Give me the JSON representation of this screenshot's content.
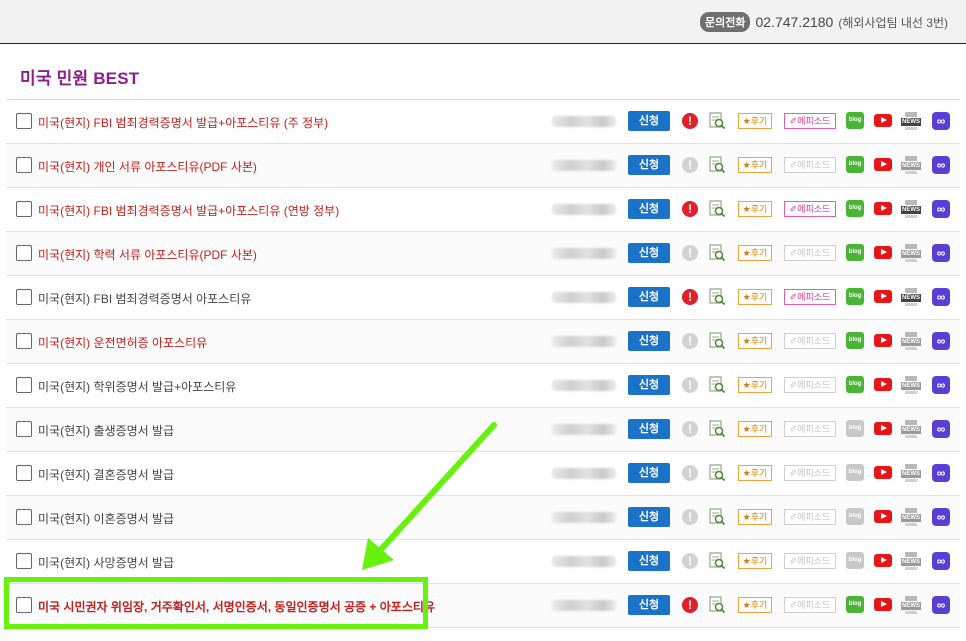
{
  "header": {
    "contact_badge": "문의전화",
    "phone": "02.747.2180",
    "note": "(해외사업팀 내선 3번)"
  },
  "section_title": "미국 민원 BEST",
  "common": {
    "apply_label": "신청",
    "review_label": "★후기",
    "episode_label": "✐에피소드",
    "alert_glyph": "!",
    "blog_label": "blog",
    "news_label": "NEWS",
    "link_glyph": "∞"
  },
  "rows": [
    {
      "name": "미국(현지) FBI 범죄경력증명서 발급+아포스티유 (주 정부)",
      "red": true,
      "alert": true,
      "episode": true,
      "blog": true,
      "news": true
    },
    {
      "name": "미국(현지) 개인 서류 아포스티유(PDF 사본)",
      "red": true,
      "alert": false,
      "episode": false,
      "blog": true,
      "news": false
    },
    {
      "name": "미국(현지) FBI 범죄경력증명서 발급+아포스티유 (연방 정부)",
      "red": true,
      "alert": true,
      "episode": true,
      "blog": true,
      "news": true
    },
    {
      "name": "미국(현지) 학력 서류 아포스티유(PDF 사본)",
      "red": true,
      "alert": false,
      "episode": false,
      "blog": true,
      "news": false
    },
    {
      "name": "미국(현지) FBI 범죄경력증명서 아포스티유",
      "red": false,
      "alert": true,
      "episode": true,
      "blog": true,
      "news": true
    },
    {
      "name": "미국(현지) 운전면허증 아포스티유",
      "red": true,
      "alert": false,
      "episode": false,
      "blog": true,
      "news": false
    },
    {
      "name": "미국(현지) 학위증명서 발급+아포스티유",
      "red": false,
      "alert": false,
      "episode": false,
      "blog": true,
      "news": false
    },
    {
      "name": "미국(현지) 출생증명서 발급",
      "red": false,
      "alert": false,
      "episode": false,
      "blog": false,
      "news": false
    },
    {
      "name": "미국(현지) 결혼증명서 발급",
      "red": false,
      "alert": false,
      "episode": false,
      "blog": false,
      "news": false
    },
    {
      "name": "미국(현지) 이혼증명서 발급",
      "red": false,
      "alert": false,
      "episode": false,
      "blog": false,
      "news": false
    },
    {
      "name": "미국(현지) 사망증명서 발급",
      "red": false,
      "alert": false,
      "episode": false,
      "blog": false,
      "news": false
    },
    {
      "name": "미국 시민권자 위임장, 거주확인서, 서명인증서, 동일인증명서 공증 + 아포스티유",
      "red": true,
      "bold": true,
      "alert": true,
      "episode": false,
      "blog": true,
      "news": false
    }
  ],
  "colors": {
    "title": "#8a1f8a",
    "highlight": "#66f20d",
    "apply": "#1a73c9",
    "red_text": "#c1201c"
  }
}
